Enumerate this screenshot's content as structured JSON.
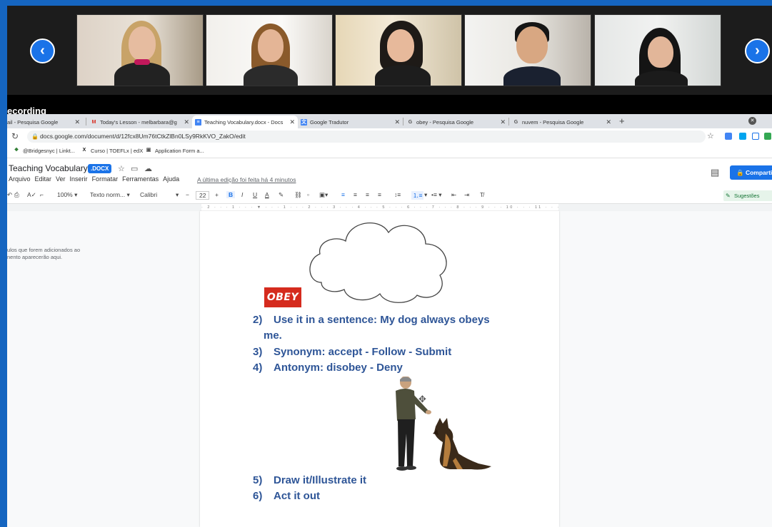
{
  "recording_label": "ecording",
  "video": {
    "prev_label": "‹",
    "next_label": "›"
  },
  "tabs": [
    {
      "title": "ail - Pesquisa Google",
      "icon": "G"
    },
    {
      "title": "Today's Lesson - melbarbara@g",
      "icon": "M"
    },
    {
      "title": "Teaching Vocabulary.docx - Docs",
      "icon": "≡"
    },
    {
      "title": "Google Tradutor",
      "icon": "文"
    },
    {
      "title": "obey - Pesquisa Google",
      "icon": "G"
    },
    {
      "title": "nuvem - Pesquisa Google",
      "icon": "G"
    }
  ],
  "tab_close": "✕",
  "new_tab": "+",
  "url": "docs.google.com/document/d/12fcx8Um76tCtkZlBn0LSy9RkKVO_ZakO/edit",
  "bookmarks": [
    {
      "label": "@Bridgesnyc | Linkt...",
      "icon": "❖",
      "color": "#2e7d32"
    },
    {
      "label": "Curso | TOEFLx | edX",
      "icon": "X",
      "color": "#222"
    },
    {
      "label": "Application Form a...",
      "icon": "▣",
      "color": "#555"
    }
  ],
  "doc": {
    "title": "Teaching Vocabulary",
    "badge": ".DOCX",
    "menu": [
      "Arquivo",
      "Editar",
      "Ver",
      "Inserir",
      "Formatar",
      "Ferramentas",
      "Ajuda"
    ],
    "last_edit": "A última edição foi feita há 4 minutos",
    "share_label": "Comparti"
  },
  "toolbar": {
    "zoom": "100%",
    "style": "Texto norm...",
    "font": "Calibri",
    "size": "22",
    "bold": "B",
    "italic": "I",
    "underline": "U",
    "text_color": "A",
    "suggestions": "Sugestões"
  },
  "ruler": "· 2 · · · 1 · · · ▼ · · · 1 · · · 2 · · · 3 · · · 4 · · · 5 · · · 6 · · · 7 · · · 8 · · · 9 · · · 10 · · · 11 · · · 12 · · · 13 · · · 14 · · · 15 · · · 16 · ▼ 17 · · · 18 · · · 19",
  "outline_hint": [
    "ulos que forem adicionados ao",
    "nento aparecerão aqui."
  ],
  "content": {
    "obey_logo": "OBEY",
    "items": [
      {
        "num": "2)",
        "text": "Use it in a sentence: My dog always obeys"
      },
      {
        "num": "3)",
        "text": "Synonym: accept - Follow - Submit"
      },
      {
        "num": "4)",
        "text": "Antonym: disobey - Deny"
      },
      {
        "num": "5)",
        "text": "Draw it/Illustrate it"
      },
      {
        "num": "6)",
        "text": "Act it out"
      }
    ],
    "item2_cont": "me."
  }
}
